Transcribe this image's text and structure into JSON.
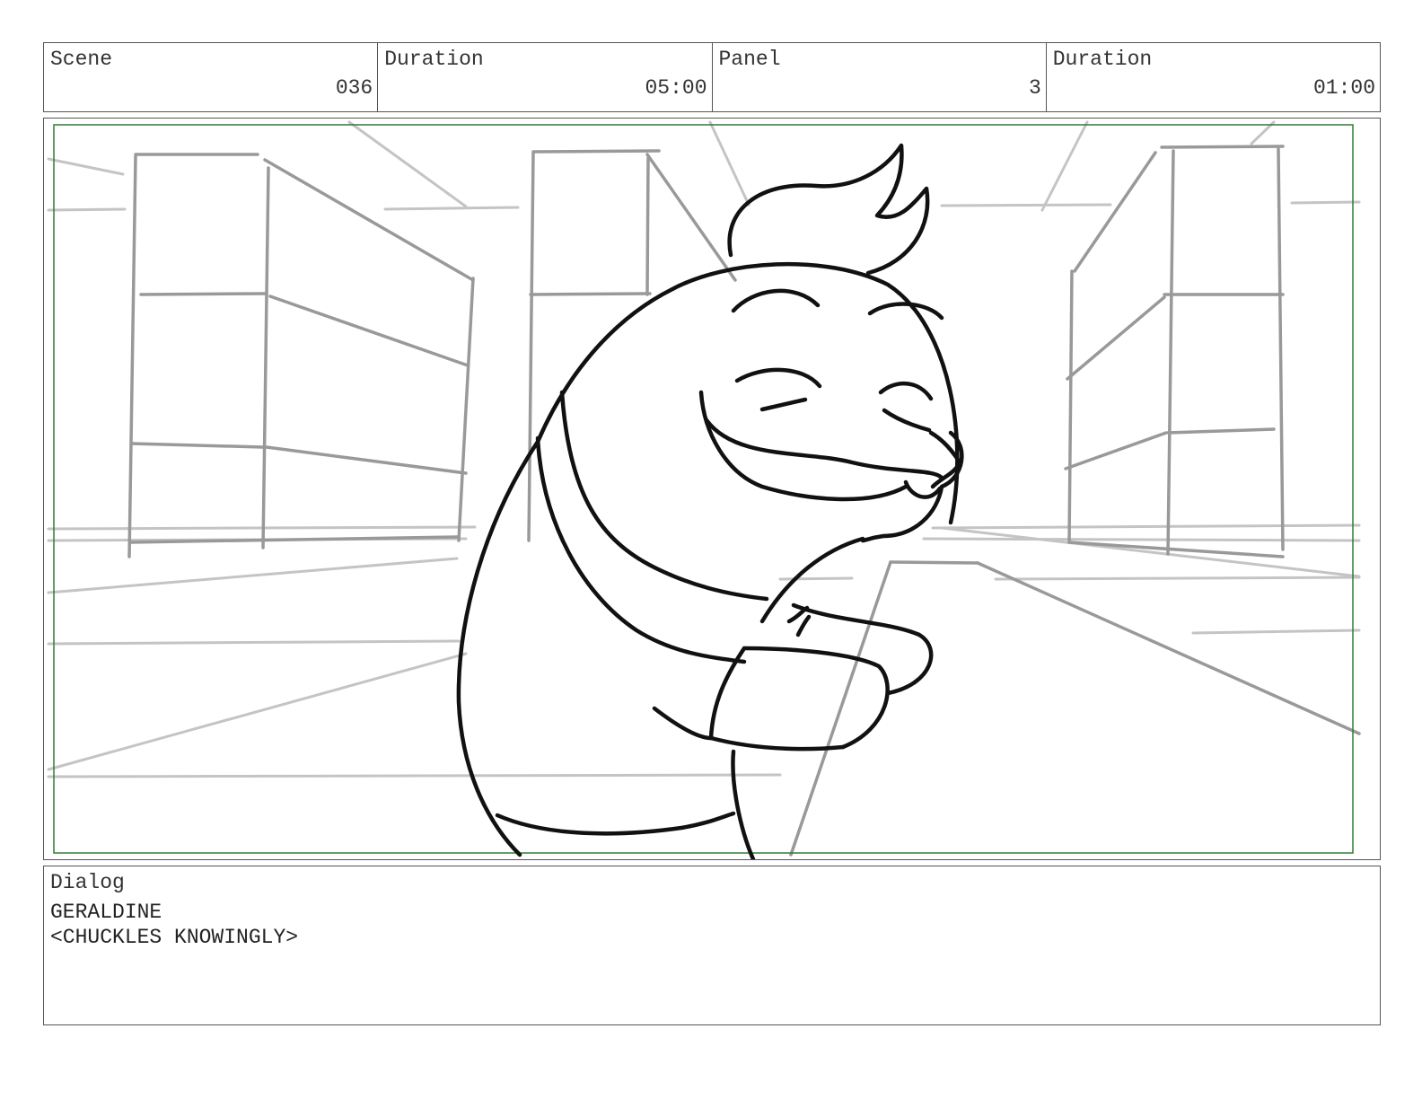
{
  "header": {
    "scene_label": "Scene",
    "scene_value": "036",
    "scene_duration_label": "Duration",
    "scene_duration_value": "05:00",
    "panel_label": "Panel",
    "panel_value": "3",
    "panel_duration_label": "Duration",
    "panel_duration_value": "01:00"
  },
  "colors": {
    "safe_frame": "#2e7d32",
    "border": "#555555",
    "sketch_light": "#c4c4c4",
    "sketch_mid": "#999999",
    "ink": "#111111"
  },
  "dialog": {
    "label": "Dialog",
    "lines": [
      "GERALDINE",
      "<CHUCKLES KNOWINGLY>"
    ]
  }
}
